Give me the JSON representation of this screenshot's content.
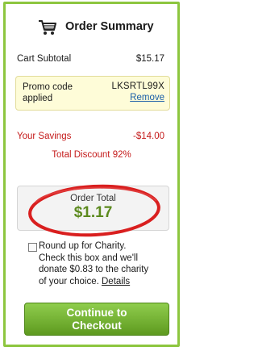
{
  "header": {
    "icon": "shopping-cart-icon",
    "title": "Order Summary"
  },
  "subtotal": {
    "label": "Cart Subtotal",
    "value": "$15.17"
  },
  "promo": {
    "label": "Promo code applied",
    "code": "LKSRTL99X",
    "remove_label": "Remove"
  },
  "savings": {
    "label": "Your Savings",
    "value": "-$14.00"
  },
  "discount": {
    "text": "Total Discount 92%"
  },
  "total": {
    "label": "Order Total",
    "value": "$1.17"
  },
  "charity": {
    "checked": false,
    "lines": [
      "Round up for Charity.",
      "Check this box and we'll",
      "donate $0.83 to the charity",
      "of your choice."
    ],
    "details_label": "Details"
  },
  "checkout": {
    "line1": "Continue to",
    "line2": "Checkout"
  },
  "colors": {
    "border_green": "#8dc63f",
    "savings_red": "#c41a1a",
    "total_green": "#5c8a1e",
    "link_blue": "#1a5fa8",
    "promo_bg": "#fefcd8",
    "button_green": "#6fae2f"
  }
}
